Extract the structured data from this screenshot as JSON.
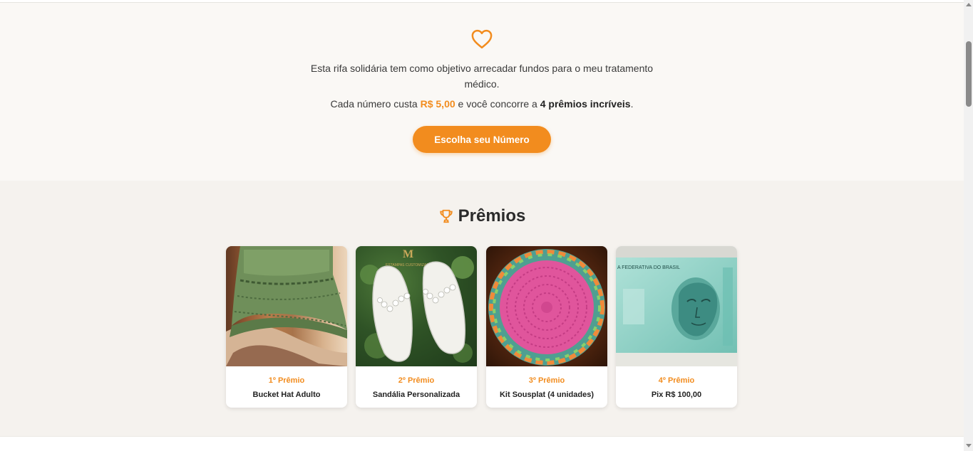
{
  "hero": {
    "intro": "Esta rifa solidária tem como objetivo arrecadar fundos para o meu tratamento médico.",
    "price_prefix": "Cada número custa ",
    "price": "R$ 5,00",
    "price_middle": " e você concorre a ",
    "prizes_count": "4 prêmios incríveis",
    "price_suffix": ".",
    "cta_label": "Escolha seu Número",
    "icon": "heart-icon",
    "accent_color": "#f28c1e"
  },
  "prizes": {
    "title": "Prêmios",
    "icon": "trophy-icon",
    "items": [
      {
        "rank": "1º Prêmio",
        "name": "Bucket Hat Adulto",
        "image": "green-crochet-bucket-hat"
      },
      {
        "rank": "2º Prêmio",
        "name": "Sandália Personalizada",
        "image": "white-pearl-flip-flops"
      },
      {
        "rank": "3º Prêmio",
        "name": "Kit Sousplat (4 unidades)",
        "image": "pink-crochet-placemat"
      },
      {
        "rank": "4º Prêmio",
        "name": "Pix R$ 100,00",
        "image": "brazilian-100-reais-banknote"
      }
    ]
  },
  "banknote_text": "A FEDERATIVA DO BRASIL"
}
